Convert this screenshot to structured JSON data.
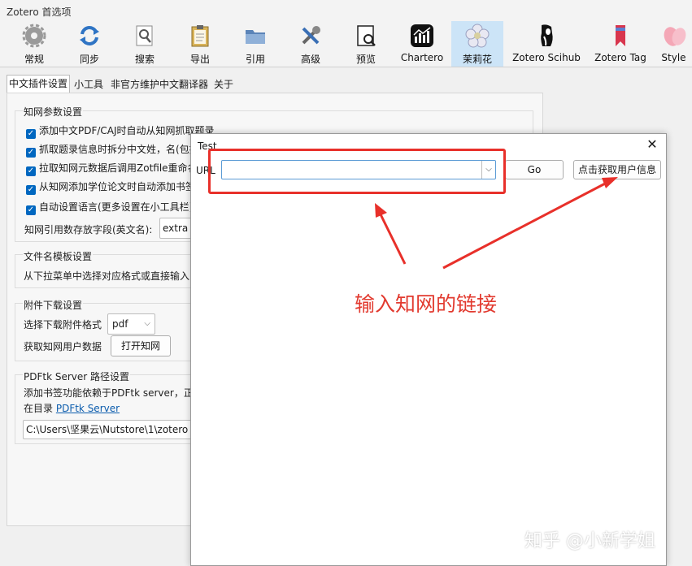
{
  "window": {
    "title": "Zotero 首选项"
  },
  "toolbar": {
    "items": [
      {
        "label": "常规",
        "icon": "gear-icon"
      },
      {
        "label": "同步",
        "icon": "sync-icon"
      },
      {
        "label": "搜索",
        "icon": "search-icon"
      },
      {
        "label": "导出",
        "icon": "clipboard-icon"
      },
      {
        "label": "引用",
        "icon": "folder-icon"
      },
      {
        "label": "高级",
        "icon": "tools-icon"
      },
      {
        "label": "预览",
        "icon": "preview-icon"
      },
      {
        "label": "Chartero",
        "icon": "chart-icon"
      },
      {
        "label": "茉莉花",
        "icon": "jasmine-flower-icon",
        "selected": true
      },
      {
        "label": "Zotero Scihub",
        "icon": "scihub-icon"
      },
      {
        "label": "Zotero Tag",
        "icon": "bookmark-icon"
      },
      {
        "label": "Style",
        "icon": "petal-icon"
      }
    ]
  },
  "tabs": [
    {
      "label": "中文插件设置",
      "selected": true
    },
    {
      "label": "小工具"
    },
    {
      "label": "非官方维护中文翻译器"
    },
    {
      "label": "关于"
    }
  ],
  "cnki": {
    "title": "知网参数设置",
    "checkboxes": [
      {
        "label": "添加中文PDF/CAJ时自动从知网抓取题录",
        "checked": true
      },
      {
        "label": "抓取题录信息时拆分中文姓，名(包括",
        "checked": true
      },
      {
        "label": "拉取知网元数据后调用Zotfile重命名",
        "checked": true
      },
      {
        "label": "从知网添加学位论文时自动添加书签",
        "checked": true
      },
      {
        "label": "自动设置语言(更多设置在小工具栏)",
        "checked": true
      }
    ],
    "field_label": "知网引用数存放字段(英文名):",
    "field_value": "extra"
  },
  "filename": {
    "title": "文件名模板设置",
    "desc": "从下拉菜单中选择对应格式或直接输入"
  },
  "attachment": {
    "title": "附件下载设置",
    "format_label": "选择下载附件格式",
    "format_value": "pdf",
    "userdata_label": "获取知网用户数据",
    "open_button": "打开知网"
  },
  "pdftk": {
    "title": "PDFtk Server 路径设置",
    "desc": "添加书签功能依赖于PDFtk server，正",
    "dir_prefix": "在目录",
    "link": "PDFtk Server",
    "path": "C:\\Users\\坚果云\\Nutstore\\1\\zotero"
  },
  "dialog": {
    "title": "Test",
    "url_label": "URL",
    "url_value": "",
    "go_button": "Go",
    "fetch_button": "点击获取用户信息"
  },
  "annotation": {
    "text": "输入知网的链接",
    "color": "#e23a2f"
  },
  "watermark": "知乎 @小新学姐"
}
